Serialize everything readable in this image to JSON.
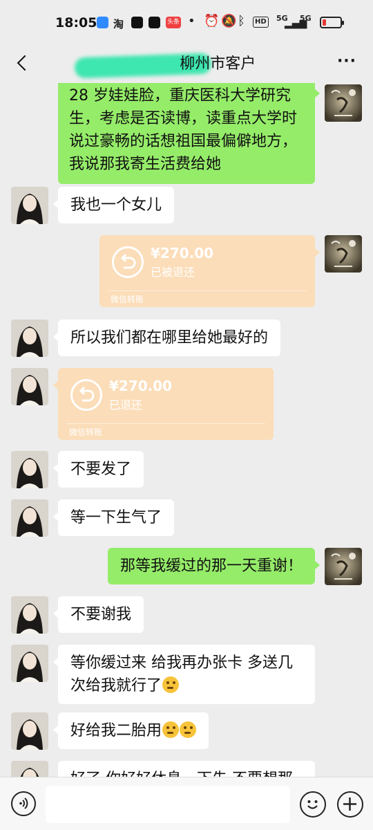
{
  "status_bar": {
    "time": "18:05",
    "app_icons": [
      {
        "name": "app-icon-blue",
        "color": "#2f8bff"
      },
      {
        "name": "app-icon-taobao",
        "text": "淘"
      },
      {
        "name": "app-icon-tiktok",
        "color": "#111111"
      },
      {
        "name": "app-icon-tiktok-2",
        "color": "#111111"
      },
      {
        "name": "app-icon-toutiao",
        "text": "头条",
        "color": "#f04142"
      }
    ],
    "hd_label": "HD",
    "network_1": "5G",
    "network_2": "5G",
    "battery_level": 0.2,
    "battery_color": "#e53935"
  },
  "header": {
    "title": "柳州市客户",
    "back_icon": "chevron-left-icon",
    "more_label": "···"
  },
  "messages": [
    {
      "side": "out",
      "type": "text",
      "text": "28 岁娃娃脸，重庆医科大学研究生，考虑是否读博，读重点大学时说过豪畅的话想祖国最偏僻地方，我说那我寄生活费给她"
    },
    {
      "side": "in",
      "type": "text",
      "text": "我也一个女儿"
    },
    {
      "side": "out",
      "type": "transfer",
      "amount": "¥270.00",
      "status": "已被退还",
      "footer": "微信转账"
    },
    {
      "side": "in",
      "type": "text",
      "text": "所以我们都在哪里给她最好的"
    },
    {
      "side": "in",
      "type": "transfer",
      "amount": "¥270.00",
      "status": "已退还",
      "footer": "微信转账"
    },
    {
      "side": "in",
      "type": "text",
      "text": "不要发了"
    },
    {
      "side": "in",
      "type": "text",
      "text": "等一下生气了"
    },
    {
      "side": "out",
      "type": "text",
      "text": "那等我缓过的那一天重谢！"
    },
    {
      "side": "in",
      "type": "text",
      "text": "不要谢我"
    },
    {
      "side": "in",
      "type": "text",
      "text": "等你缓过来 给我再办张卡 多送几次给我就行了",
      "emoji_count": 1
    },
    {
      "side": "in",
      "type": "text",
      "text": "好给我二胎用",
      "emoji_count": 2
    },
    {
      "side": "in",
      "type": "text",
      "text": "好了 你好好休息一下先 不要想那"
    }
  ],
  "colors": {
    "background": "#ededed",
    "outgoing_bubble": "#95ec69",
    "incoming_bubble": "#ffffff",
    "transfer_bubble": "#fbddb9"
  },
  "input_bar": {
    "value": "",
    "voice_icon": "voice-icon",
    "emoji_icon": "emoji-icon",
    "plus_icon": "plus-icon"
  }
}
